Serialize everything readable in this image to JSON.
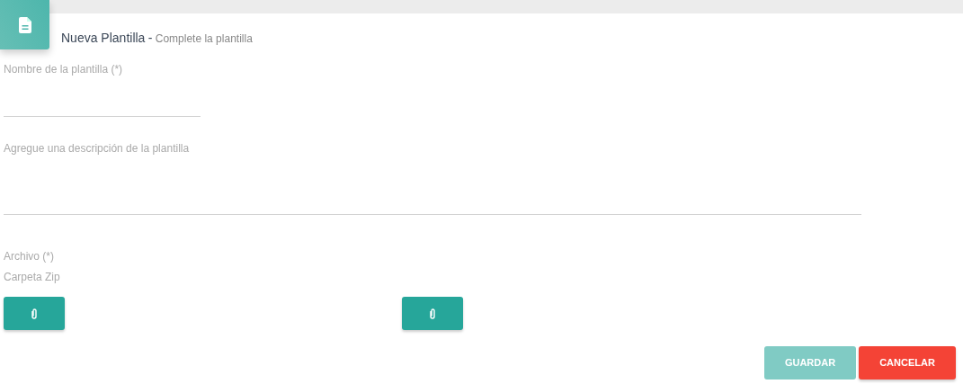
{
  "header": {
    "title": "Nueva Plantilla",
    "separator": "-",
    "subtitle": "Complete la plantilla"
  },
  "fields": [
    {
      "kind": "input",
      "label": "Nombre de la plantilla (*)"
    },
    {
      "kind": "textarea",
      "label": "Agregue una descripción de la plantilla"
    }
  ],
  "file_section": {
    "label": "Archivo (*)",
    "sublabel": "Carpeta Zip",
    "attach_buttons": [
      {
        "kind": "attach"
      },
      {
        "kind": "attach"
      }
    ]
  },
  "actions": [
    {
      "label": "GUARDAR",
      "kind": "save",
      "disabled": true
    },
    {
      "label": "CANCELAR",
      "kind": "cancel",
      "disabled": false
    }
  ]
}
